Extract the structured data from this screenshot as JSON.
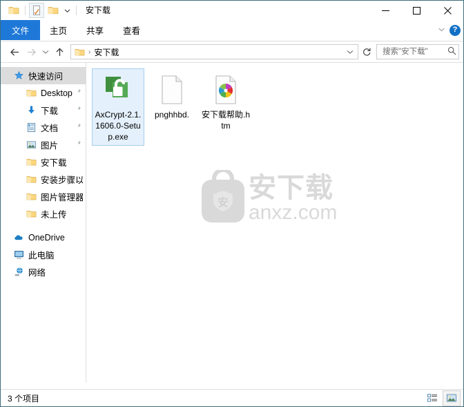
{
  "window": {
    "title": "安下载",
    "quick_access_toolbar": [
      {
        "name": "folder-icon",
        "label": "属性"
      },
      {
        "name": "properties-icon",
        "label": "属性"
      },
      {
        "name": "new-folder-icon",
        "label": "新建文件夹"
      },
      {
        "name": "chevron-down-icon",
        "label": "自定义快速访问工具栏"
      }
    ],
    "controls": {
      "minimize": "—",
      "maximize": "☐",
      "close": "✕"
    }
  },
  "ribbon": {
    "tabs": [
      {
        "label": "文件",
        "active": true
      },
      {
        "label": "主页",
        "active": false
      },
      {
        "label": "共享",
        "active": false
      },
      {
        "label": "查看",
        "active": false
      }
    ],
    "expand_label": "⌄",
    "help_label": "?"
  },
  "address": {
    "back_label": "←",
    "forward_label": "→",
    "recent_label": "⌄",
    "up_label": "↑",
    "breadcrumb": [
      "安下载"
    ],
    "breadcrumb_sep": "›",
    "dropdown_label": "⌄",
    "refresh_label": "↻"
  },
  "search": {
    "placeholder": "搜索\"安下载\"",
    "value": "",
    "icon": "search-icon"
  },
  "sidebar": {
    "items": [
      {
        "label": "快速访问",
        "icon": "star-icon",
        "indent": 0,
        "selected": true,
        "pinned": false
      },
      {
        "label": "Desktop",
        "icon": "folder-icon",
        "indent": 1,
        "selected": false,
        "pinned": true
      },
      {
        "label": "下载",
        "icon": "download-icon",
        "indent": 1,
        "selected": false,
        "pinned": true
      },
      {
        "label": "文档",
        "icon": "documents-icon",
        "indent": 1,
        "selected": false,
        "pinned": true
      },
      {
        "label": "图片",
        "icon": "pictures-icon",
        "indent": 1,
        "selected": false,
        "pinned": true
      },
      {
        "label": "安下载",
        "icon": "folder-icon",
        "indent": 1,
        "selected": false,
        "pinned": false
      },
      {
        "label": "安装步骤以及",
        "icon": "folder-icon",
        "indent": 1,
        "selected": false,
        "pinned": false
      },
      {
        "label": "图片管理器",
        "icon": "folder-icon",
        "indent": 1,
        "selected": false,
        "pinned": false
      },
      {
        "label": "未上传",
        "icon": "folder-icon",
        "indent": 1,
        "selected": false,
        "pinned": false
      },
      {
        "label": "OneDrive",
        "icon": "cloud-icon",
        "indent": 0,
        "selected": false,
        "pinned": false
      },
      {
        "label": "此电脑",
        "icon": "computer-icon",
        "indent": 0,
        "selected": false,
        "pinned": false
      },
      {
        "label": "网络",
        "icon": "network-icon",
        "indent": 0,
        "selected": false,
        "pinned": false
      }
    ]
  },
  "files": [
    {
      "name": "AxCrypt-2.1.1606.0-Setup.exe",
      "icon": "padlock-icon",
      "selected": true
    },
    {
      "name": "pnghhbd.",
      "icon": "blank-document-icon",
      "selected": false
    },
    {
      "name": "安下载帮助.htm",
      "icon": "browser-document-icon",
      "selected": false
    }
  ],
  "watermark": {
    "cn": "安下载",
    "en": "anxz.com",
    "badge": "安"
  },
  "statusbar": {
    "count_text": "3 个项目",
    "views": [
      {
        "name": "details-view-button",
        "active": false
      },
      {
        "name": "large-icons-view-button",
        "active": true
      }
    ]
  },
  "colors": {
    "accent": "#1e78d7",
    "selection_bg": "#e4f0fb",
    "selection_border": "#a5cdf0",
    "window_border": "#3d6e7a",
    "watermark": "#d9d9d9"
  }
}
